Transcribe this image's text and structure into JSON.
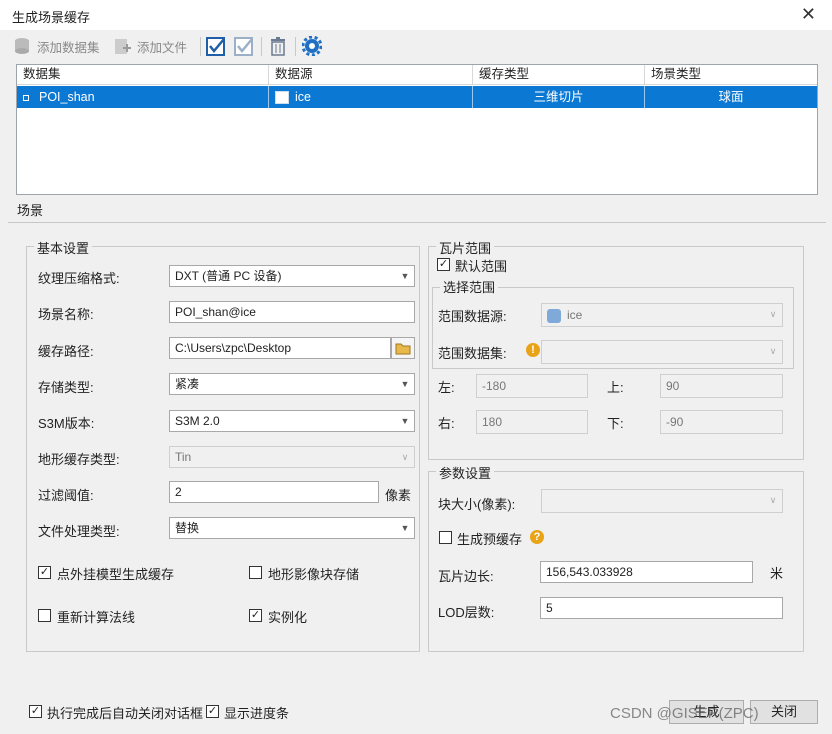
{
  "window": {
    "title": "生成场景缓存"
  },
  "toolbar": {
    "add_dataset": "添加数据集",
    "add_file": "添加文件"
  },
  "grid": {
    "headers": [
      "数据集",
      "数据源",
      "缓存类型",
      "场景类型"
    ],
    "rows": [
      {
        "dataset": "POI_shan",
        "datasource": "ice",
        "cache_type": "三维切片",
        "scene_type": "球面"
      }
    ]
  },
  "tab": {
    "label": "场景"
  },
  "basic": {
    "title": "基本设置",
    "compress_label": "纹理压缩格式:",
    "compress_value": "DXT (普通 PC 设备)",
    "scene_name_label": "场景名称:",
    "scene_name_value": "POI_shan@ice",
    "cache_path_label": "缓存路径:",
    "cache_path_value": "C:\\Users\\zpc\\Desktop",
    "storage_label": "存储类型:",
    "storage_value": "紧凑",
    "s3m_label": "S3M版本:",
    "s3m_value": "S3M 2.0",
    "terrain_label": "地形缓存类型:",
    "terrain_value": "Tin",
    "filter_label": "过滤阈值:",
    "filter_value": "2",
    "filter_unit": "像素",
    "file_proc_label": "文件处理类型:",
    "file_proc_value": "替换",
    "cb_point_model": "点外挂模型生成缓存",
    "cb_terrain_image": "地形影像块存储",
    "cb_recalc_normals": "重新计算法线",
    "cb_instancing": "实例化"
  },
  "tile_range": {
    "title": "瓦片范围",
    "default_range": "默认范围",
    "select_title": "选择范围",
    "source_label": "范围数据源:",
    "source_value": "ice",
    "dataset_label": "范围数据集:",
    "left_label": "左:",
    "left_value": "-180",
    "top_label": "上:",
    "top_value": "90",
    "right_label": "右:",
    "right_value": "180",
    "bottom_label": "下:",
    "bottom_value": "-90"
  },
  "params": {
    "title": "参数设置",
    "block_label": "块大小(像素):",
    "gen_pre_cache": "生成预缓存",
    "tile_side_label": "瓦片边长:",
    "tile_side_value": "156,543.033928",
    "tile_side_unit": "米",
    "lod_label": "LOD层数:",
    "lod_value": "5"
  },
  "footer": {
    "auto_close": "执行完成后自动关闭对话框",
    "show_progress": "显示进度条",
    "generate": "生成",
    "close": "关闭",
    "watermark": "CSDN @GISER(ZPC)"
  }
}
